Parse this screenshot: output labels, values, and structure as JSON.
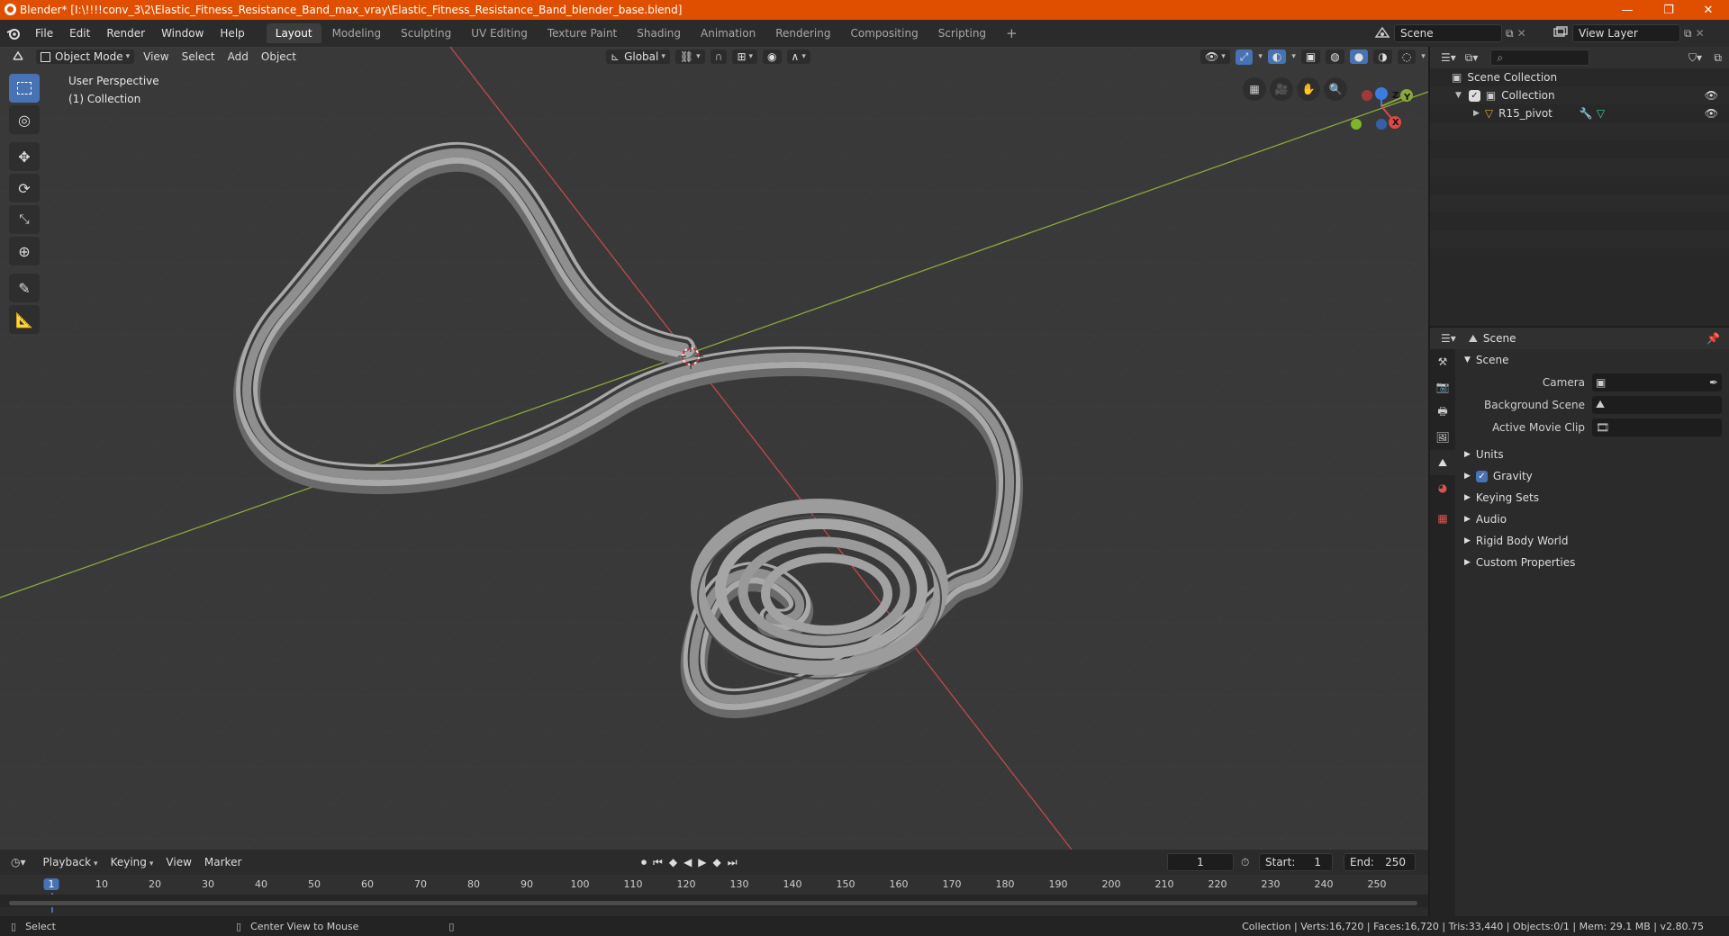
{
  "window": {
    "title": "Blender* [I:\\!!!!conv_3\\2\\Elastic_Fitness_Resistance_Band_max_vray\\Elastic_Fitness_Resistance_Band_blender_base.blend]",
    "minimize": "—",
    "maximize": "❐",
    "close": "✕"
  },
  "menu": {
    "items": [
      "File",
      "Edit",
      "Render",
      "Window",
      "Help"
    ]
  },
  "workspaces": {
    "tabs": [
      "Layout",
      "Modeling",
      "Sculpting",
      "UV Editing",
      "Texture Paint",
      "Shading",
      "Animation",
      "Rendering",
      "Compositing",
      "Scripting"
    ],
    "active": "Layout",
    "add": "+"
  },
  "scene_selector": {
    "value": "Scene"
  },
  "view_layer_selector": {
    "value": "View Layer"
  },
  "viewport": {
    "mode": "Object Mode",
    "menus": [
      "View",
      "Select",
      "Add",
      "Object"
    ],
    "transform_orientation": "Global",
    "perspective_label": "User Perspective",
    "collection_label": "(1) Collection",
    "gizmo": {
      "x": "X",
      "y": "Y",
      "z": "Z"
    }
  },
  "outliner": {
    "root": "Scene Collection",
    "collection": "Collection",
    "object": "R15_pivot"
  },
  "properties": {
    "header": "Scene",
    "section": "Scene",
    "fields": [
      {
        "label": "Camera",
        "value": ""
      },
      {
        "label": "Background Scene",
        "value": ""
      },
      {
        "label": "Active Movie Clip",
        "value": ""
      }
    ],
    "panels": [
      "Units",
      "Gravity",
      "Keying Sets",
      "Audio",
      "Rigid Body World",
      "Custom Properties"
    ],
    "gravity_checked": true
  },
  "timeline": {
    "menus": [
      "Playback",
      "Keying",
      "View",
      "Marker"
    ],
    "current_frame": "1",
    "start_label": "Start:",
    "start": "1",
    "end_label": "End:",
    "end": "250",
    "ruler": [
      "1",
      "10",
      "20",
      "30",
      "40",
      "50",
      "60",
      "70",
      "80",
      "90",
      "100",
      "110",
      "120",
      "130",
      "140",
      "150",
      "160",
      "170",
      "180",
      "190",
      "200",
      "210",
      "220",
      "230",
      "240",
      "250"
    ]
  },
  "statusbar": {
    "left_action": "Select",
    "middle_action": "Center View to Mouse",
    "stats": "Collection | Verts:16,720 | Faces:16,720 | Tris:33,440 | Objects:0/1 | Mem: 29.1 MB | v2.80.75"
  },
  "colors": {
    "titlebar": "#e04f00",
    "accent": "#4772b3",
    "viewport_bg": "#393939",
    "axis_x": "#c54848",
    "axis_y": "#8aa83c"
  }
}
